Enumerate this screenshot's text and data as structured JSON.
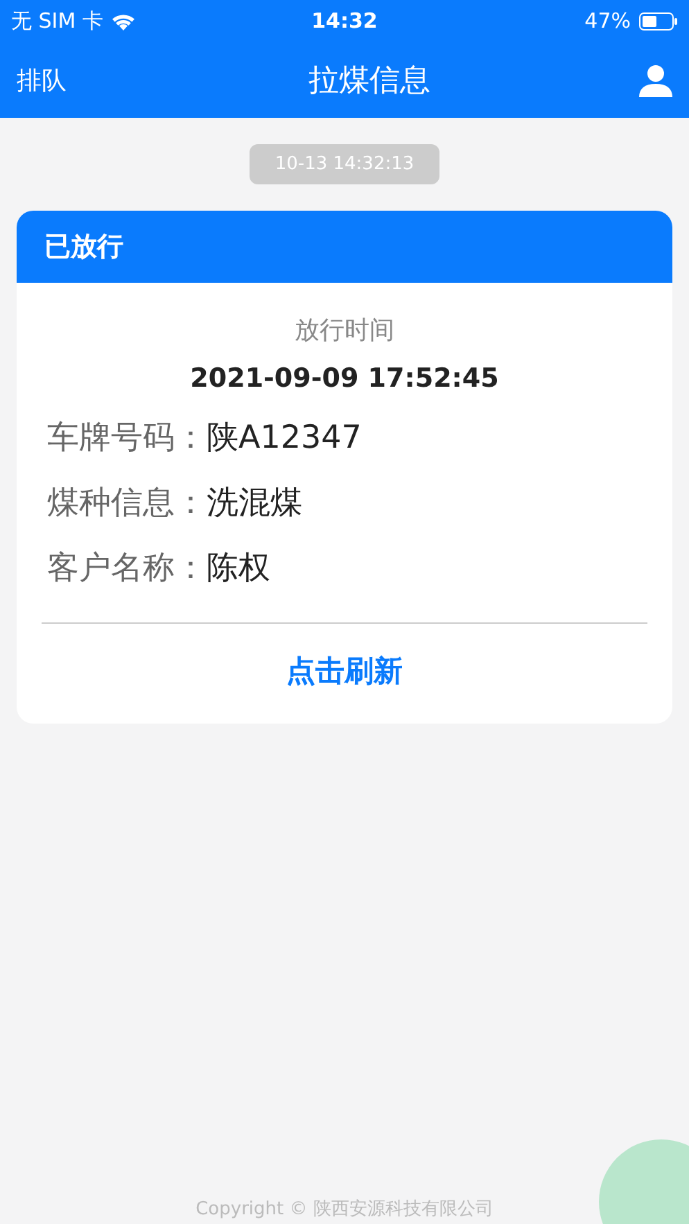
{
  "status_bar": {
    "carrier": "无 SIM 卡",
    "time": "14:32",
    "battery_percent": "47%"
  },
  "nav": {
    "left": "排队",
    "title": "拉煤信息"
  },
  "timestamp": "10-13 14:32:13",
  "card": {
    "status": "已放行",
    "time_label": "放行时间",
    "time_value": "2021-09-09 17:52:45",
    "fields": [
      {
        "label": "车牌号码：",
        "value": "陕A12347"
      },
      {
        "label": "煤种信息：",
        "value": "洗混煤"
      },
      {
        "label": "客户名称：",
        "value": "陈权"
      }
    ],
    "action": "点击刷新"
  },
  "footer": "Copyright © 陕西安源科技有限公司"
}
